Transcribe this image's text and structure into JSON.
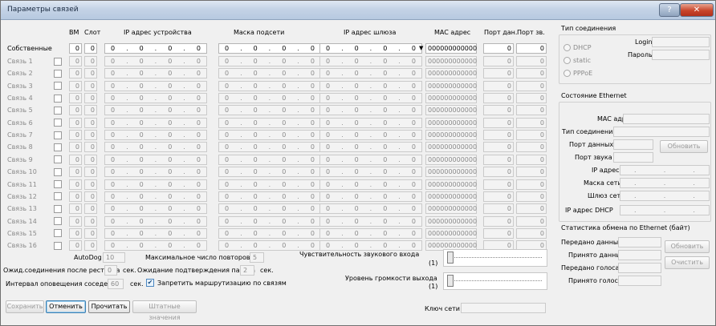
{
  "window": {
    "title": "Параметры связей",
    "help": "?",
    "close": "✕"
  },
  "headers": {
    "vm": "ВМ",
    "slot": "Слот",
    "ip_dev": "IP адрес устройства",
    "mask": "Маска подсети",
    "gw": "IP адрес шлюза",
    "mac": "MAC адрес",
    "port_data": "Порт дан.",
    "port_sound": "Порт зв."
  },
  "own": {
    "label": "Собственные",
    "vm": "0",
    "slot": "0",
    "ip": [
      "0",
      "0",
      "0",
      "0"
    ],
    "mask": [
      "0",
      "0",
      "0",
      "0"
    ],
    "gw": [
      "0",
      "0",
      "0",
      "0"
    ],
    "mac": "000000000000",
    "port_data": "0",
    "port_sound": "0"
  },
  "links": [
    {
      "label": "Связь 1"
    },
    {
      "label": "Связь 2"
    },
    {
      "label": "Связь 3"
    },
    {
      "label": "Связь 4"
    },
    {
      "label": "Связь 5"
    },
    {
      "label": "Связь 6"
    },
    {
      "label": "Связь 7"
    },
    {
      "label": "Связь 8"
    },
    {
      "label": "Связь 9"
    },
    {
      "label": "Связь 10"
    },
    {
      "label": "Связь 11"
    },
    {
      "label": "Связь 12"
    },
    {
      "label": "Связь 13"
    },
    {
      "label": "Связь 14"
    },
    {
      "label": "Связь 15"
    },
    {
      "label": "Связь 16"
    }
  ],
  "link_defaults": {
    "vm": "0",
    "slot": "0",
    "octet": "0",
    "mac": "000000000000",
    "port": "0"
  },
  "conn_type": {
    "label": "Тип соединения",
    "options": [
      "DHCP",
      "static",
      "PPPoE"
    ],
    "login": "Login",
    "password": "Пароль"
  },
  "eth": {
    "title": "Состояние Ethernet",
    "mac": "MAC адрес",
    "conn_type": "Тип соединения",
    "port_data": "Порт данных",
    "port_sound": "Порт звука",
    "ip": "IP адрес",
    "mask": "Маска сети",
    "gateway": "Шлюз сети",
    "dhcp": "IP адрес DHCP",
    "refresh": "Обновить"
  },
  "stats": {
    "title": "Статистика обмена по Ethernet (байт)",
    "sent_data": "Передано данных",
    "recv_data": "Принято данных",
    "sent_voice": "Передано голоса",
    "recv_voice": "Принято голоса",
    "refresh": "Обновить",
    "clear": "Очистить"
  },
  "bottom": {
    "autodog_label": "AutoDog",
    "autodog": "10",
    "max_retries_label": "Максимальное число повторов",
    "max_retries": "5",
    "wait_conn_label": "Ожид.соединения после рестарта",
    "wait_conn": "0",
    "sec": "сек.",
    "wait_ack_label": "Ожидание подтверждения пакета",
    "wait_ack": "2",
    "neigh_label": "Интервал оповещения соседей",
    "neigh": "60",
    "deny_routing": "Запретить маршрутизацию по связям",
    "sens_label": "Чувствительность звукового входа",
    "sens_val": "(1)",
    "vol_label": "Уровень громкости выхода",
    "vol_val": "(1)",
    "key_label": "Ключ сети"
  },
  "buttons": {
    "save": "Сохранить",
    "cancel": "Отменить",
    "read": "Прочитать",
    "defaults": "Штатные значения"
  }
}
